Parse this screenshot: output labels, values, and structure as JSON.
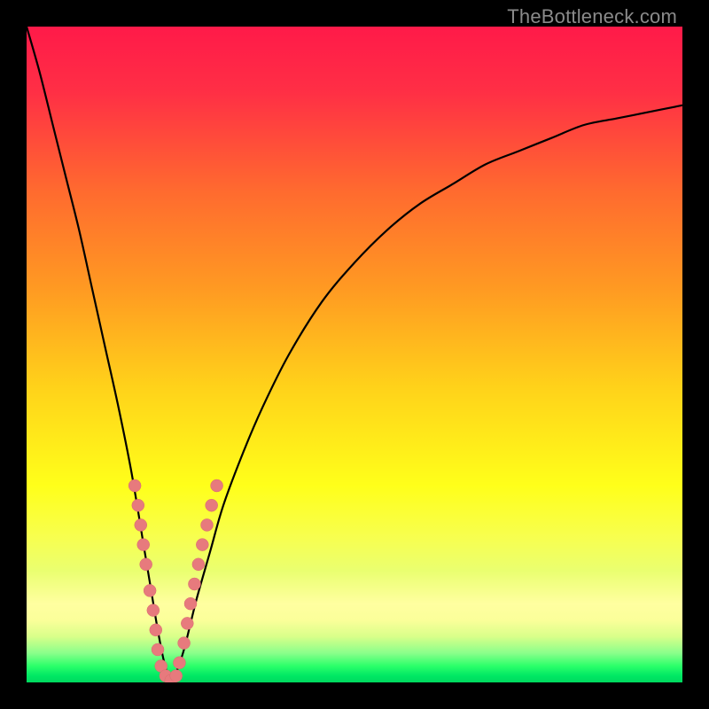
{
  "watermark": "TheBottleneck.com",
  "colors": {
    "frame": "#000000",
    "watermark": "#8a8a8a",
    "curve": "#000000",
    "marker_fill": "#e77a7d",
    "marker_stroke": "#d86b6e",
    "gradient_stops": [
      {
        "offset": 0.0,
        "color": "#ff1a49"
      },
      {
        "offset": 0.1,
        "color": "#ff2f45"
      },
      {
        "offset": 0.25,
        "color": "#ff6a2f"
      },
      {
        "offset": 0.4,
        "color": "#ff9a22"
      },
      {
        "offset": 0.55,
        "color": "#ffd21a"
      },
      {
        "offset": 0.7,
        "color": "#ffff1a"
      },
      {
        "offset": 0.78,
        "color": "#f7ff50"
      },
      {
        "offset": 0.83,
        "color": "#eaff70"
      },
      {
        "offset": 0.88,
        "color": "#ffffa0"
      },
      {
        "offset": 0.905,
        "color": "#fbff9a"
      },
      {
        "offset": 0.93,
        "color": "#d9ff8a"
      },
      {
        "offset": 0.955,
        "color": "#8bff8b"
      },
      {
        "offset": 0.975,
        "color": "#2bff6a"
      },
      {
        "offset": 0.99,
        "color": "#00e864"
      },
      {
        "offset": 1.0,
        "color": "#00d85e"
      }
    ]
  },
  "chart_data": {
    "type": "line",
    "title": "",
    "xlabel": "",
    "ylabel": "",
    "xlim": [
      0,
      100
    ],
    "ylim": [
      0,
      100
    ],
    "note": "V-shaped bottleneck curve. y≈0 at the valley near x≈22; rises steeply toward 100 on both sides. Values estimated from pixels.",
    "series": [
      {
        "name": "bottleneck-curve",
        "x": [
          0,
          2,
          4,
          6,
          8,
          10,
          12,
          14,
          16,
          18,
          19,
          20,
          21,
          22,
          23,
          24,
          25,
          26,
          28,
          30,
          33,
          36,
          40,
          45,
          50,
          55,
          60,
          65,
          70,
          75,
          80,
          85,
          90,
          95,
          100
        ],
        "y": [
          100,
          93,
          85,
          77,
          69,
          60,
          51,
          42,
          32,
          20,
          14,
          8,
          3,
          0,
          2,
          5,
          9,
          13,
          20,
          27,
          35,
          42,
          50,
          58,
          64,
          69,
          73,
          76,
          79,
          81,
          83,
          85,
          86,
          87,
          88
        ]
      }
    ],
    "markers": {
      "name": "highlighted-points",
      "note": "Pink dots clustered on both flanks of the valley, roughly y from ~5 to ~32; valley floor y≈0 between x≈20 and x≈23.",
      "points": [
        {
          "x": 16.5,
          "y": 30
        },
        {
          "x": 17.0,
          "y": 27
        },
        {
          "x": 17.4,
          "y": 24
        },
        {
          "x": 17.8,
          "y": 21
        },
        {
          "x": 18.2,
          "y": 18
        },
        {
          "x": 18.8,
          "y": 14
        },
        {
          "x": 19.3,
          "y": 11
        },
        {
          "x": 19.7,
          "y": 8
        },
        {
          "x": 20.0,
          "y": 5
        },
        {
          "x": 20.5,
          "y": 2.5
        },
        {
          "x": 21.2,
          "y": 1
        },
        {
          "x": 22.0,
          "y": 0.3
        },
        {
          "x": 22.8,
          "y": 1
        },
        {
          "x": 23.3,
          "y": 3
        },
        {
          "x": 24.0,
          "y": 6
        },
        {
          "x": 24.5,
          "y": 9
        },
        {
          "x": 25.0,
          "y": 12
        },
        {
          "x": 25.6,
          "y": 15
        },
        {
          "x": 26.2,
          "y": 18
        },
        {
          "x": 26.8,
          "y": 21
        },
        {
          "x": 27.5,
          "y": 24
        },
        {
          "x": 28.2,
          "y": 27
        },
        {
          "x": 29.0,
          "y": 30
        }
      ]
    }
  }
}
